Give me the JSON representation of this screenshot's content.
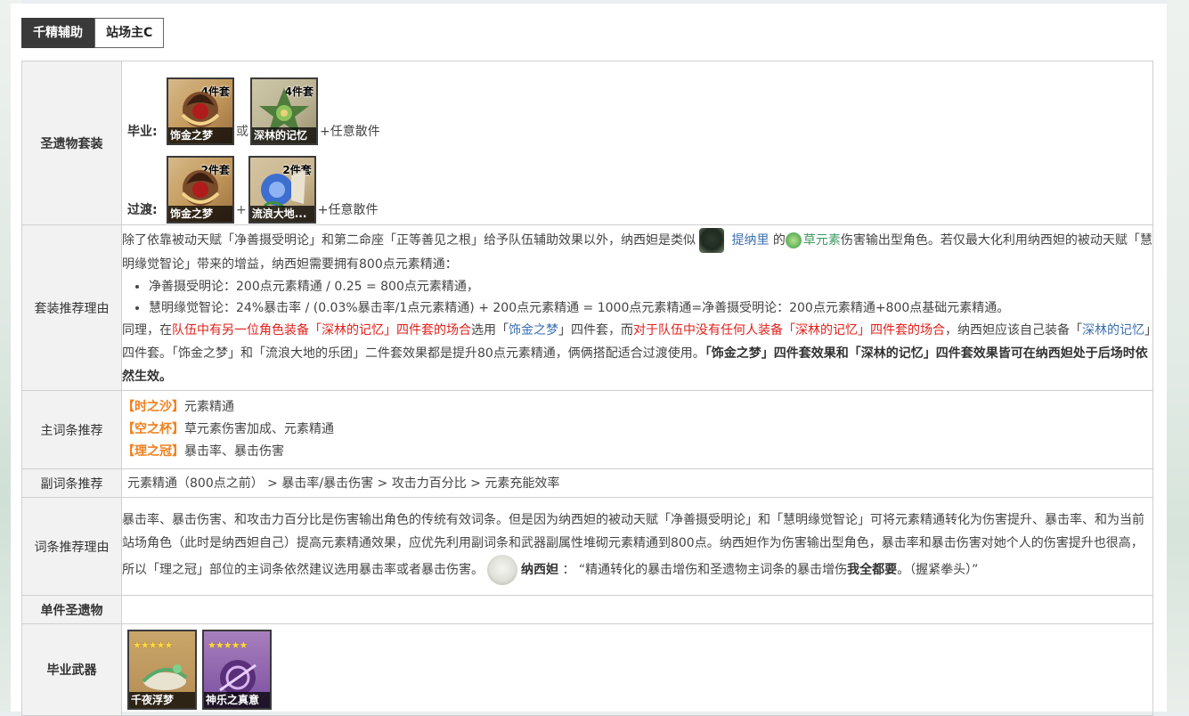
{
  "tabs": [
    {
      "label": "千精辅助",
      "active": true
    },
    {
      "label": "站场主C",
      "active": false
    }
  ],
  "rows": {
    "artifact_set": {
      "label": "圣遗物套装",
      "best": {
        "tier": "毕业:",
        "items": [
          {
            "name": "饰金之梦",
            "badge": "4件套"
          },
          {
            "name": "深林的记忆",
            "badge": "4件套"
          }
        ],
        "sep": "或",
        "tail": "+任意散件"
      },
      "transition": {
        "tier": "过渡:",
        "items": [
          {
            "name": "饰金之梦",
            "badge": "2件套"
          },
          {
            "name": "流浪大地...",
            "badge": "2件套"
          }
        ],
        "sep": "+",
        "tail": "+任意散件"
      }
    },
    "set_reason": {
      "label": "套装推荐理由",
      "p1_a": "除了依靠被动天赋「净善摄受明论」和第二命座「正等善见之根」给予队伍辅助效果以外，纳西妲是类似",
      "p1_link": "提纳里",
      "p1_b": "的",
      "p1_elem": "草元素",
      "p1_c": "伤害输出型角色。若仅最大化利用纳西妲的被动天赋「慧明缘觉智论」带来的增益，纳西妲需要拥有800点元素精通：",
      "bullets": [
        "净善摄受明论：200点元素精通 / 0.25 = 800点元素精通，",
        "慧明缘觉智论：24%暴击率 / (0.03%暴击率/1点元素精通) + 200点元素精通 = 1000点元素精通=净善摄受明论：200点元素精通+800点基础元素精通。"
      ],
      "p2_a": "同理，在",
      "p2_red1": "队伍中有另一位角色装备「深林的记忆」四件套的场合",
      "p2_b": "选用「",
      "p2_blue1": "饰金之梦",
      "p2_c": "」四件套，而",
      "p2_red2": "对于队伍中没有任何人装备「深林的记忆」四件套的场合",
      "p2_d": "，纳西妲应该自己装备「",
      "p2_blue2": "深林的记忆",
      "p2_e": "」四件套。「饰金之梦」和「流浪大地的乐团」二件套效果都是提升80点元素精通，俩俩搭配适合过渡使用。",
      "p2_bold": "「饰金之梦」四件套效果和「深林的记忆」四件套效果皆可在纳西妲处于后场时依然生效。"
    },
    "main_stat": {
      "label": "主词条推荐",
      "items": [
        {
          "slot": "【时之沙】",
          "value": "元素精通"
        },
        {
          "slot": "【空之杯】",
          "value": "草元素伤害加成、元素精通"
        },
        {
          "slot": "【理之冠】",
          "value": "暴击率、暴击伤害"
        }
      ]
    },
    "sub_stat": {
      "label": "副词条推荐",
      "value": "元素精通（800点之前）  > 暴击率/暴击伤害 > 攻击力百分比 > 元素充能效率"
    },
    "stat_reason": {
      "label": "词条推荐理由",
      "text_a": "暴击率、暴击伤害、和攻击力百分比是伤害输出角色的传统有效词条。但是因为纳西妲的被动天赋「净善摄受明论」和「慧明缘觉智论」可将元素精通转化为伤害提升、暴击率、和为当前站场角色（此时是纳西妲自己）提高元素精通效果，应优先利用副词条和武器副属性堆砌元素精通到800点。纳西妲作为伤害输出型角色，暴击率和暴击伤害对她个人的伤害提升也很高，所以「理之冠」部位的主词条依然建议选用暴击率或者暴击伤害。",
      "speaker": "纳西妲",
      "colon": "：",
      "quote_a": "“精通转化的暴击增伤和圣遗物主词条的暴击增伤",
      "quote_bold": "我全都要",
      "quote_b": "。（握紧拳头）”"
    },
    "single": {
      "label": "单件圣遗物"
    },
    "weapon": {
      "label": "毕业武器",
      "items": [
        {
          "name": "千夜浮梦",
          "stars": "★★★★★"
        },
        {
          "name": "神乐之真意",
          "stars": "★★★★★"
        }
      ]
    }
  },
  "colors": {
    "accent_blue": "#3a6fb0",
    "warn_red": "#e0201b",
    "dendro_green": "#3f9b63",
    "slot_orange": "#f0801e"
  }
}
